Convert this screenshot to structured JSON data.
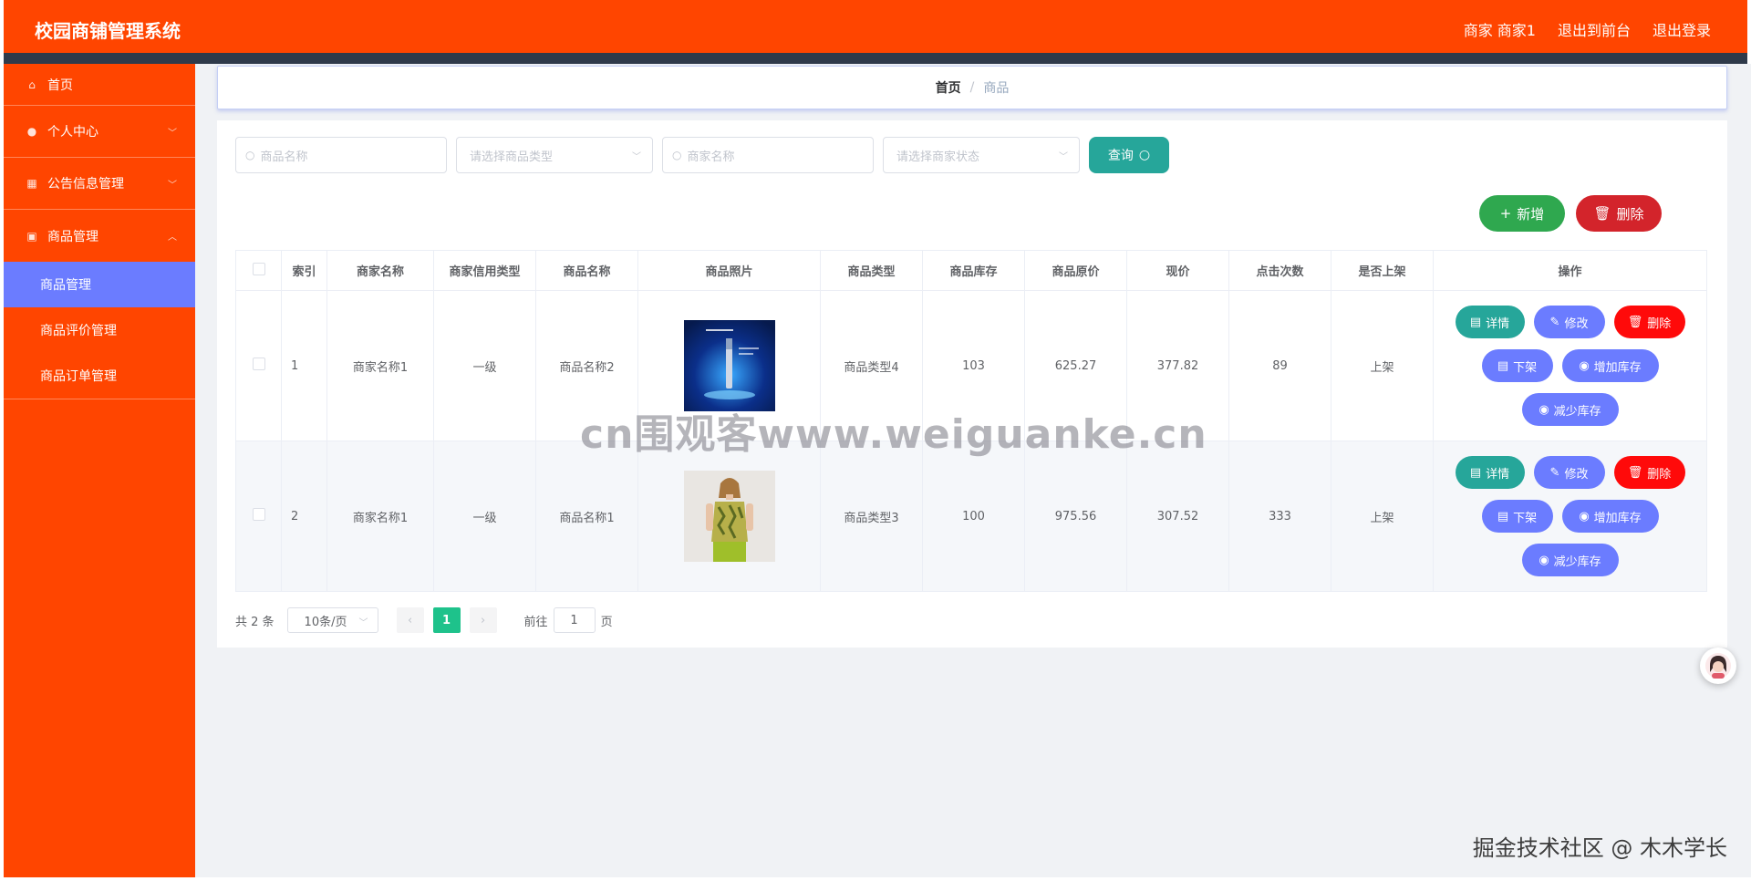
{
  "header": {
    "title": "校园商铺管理系统",
    "user": "商家 商家1",
    "front": "退出到前台",
    "logout": "退出登录"
  },
  "sidebar": {
    "home": "首页",
    "personal": "个人中心",
    "notice": "公告信息管理",
    "goods": "商品管理",
    "sub": [
      "商品管理",
      "商品评价管理",
      "商品订单管理"
    ]
  },
  "breadcrumb": {
    "home": "首页",
    "current": "商品"
  },
  "search": {
    "goods_name": "商品名称",
    "goods_type": "请选择商品类型",
    "shop_name": "商家名称",
    "shop_status": "请选择商家状态",
    "query": "查询"
  },
  "actions": {
    "add": "新增",
    "delete": "删除"
  },
  "table": {
    "headers": [
      "索引",
      "商家名称",
      "商家信用类型",
      "商品名称",
      "商品照片",
      "商品类型",
      "商品库存",
      "商品原价",
      "现价",
      "点击次数",
      "是否上架",
      "操作"
    ],
    "rows": [
      {
        "index": "1",
        "shop": "商家名称1",
        "credit": "一级",
        "name": "商品名称2",
        "type": "商品类型4",
        "stock": "103",
        "orig": "625.27",
        "price": "377.82",
        "clicks": "89",
        "onsale": "上架"
      },
      {
        "index": "2",
        "shop": "商家名称1",
        "credit": "一级",
        "name": "商品名称1",
        "type": "商品类型3",
        "stock": "100",
        "orig": "975.56",
        "price": "307.52",
        "clicks": "333",
        "onsale": "上架"
      }
    ],
    "ops": {
      "detail": "详情",
      "edit": "修改",
      "delete": "删除",
      "offsale": "下架",
      "add_stock": "增加库存",
      "reduce_stock": "减少库存"
    }
  },
  "pager": {
    "total": "共 2 条",
    "size": "10条/页",
    "page": "1",
    "goto": "前往",
    "goto_value": "1",
    "unit": "页"
  },
  "watermark": "cn围观客www.weiguanke.cn",
  "corner_mark": "掘金技术社区 @ 木木学长",
  "colors": {
    "header": "#ff4500",
    "active": "#6b7cff",
    "teal": "#26a69a",
    "green": "#2fa84f",
    "red": "#d3242b"
  }
}
